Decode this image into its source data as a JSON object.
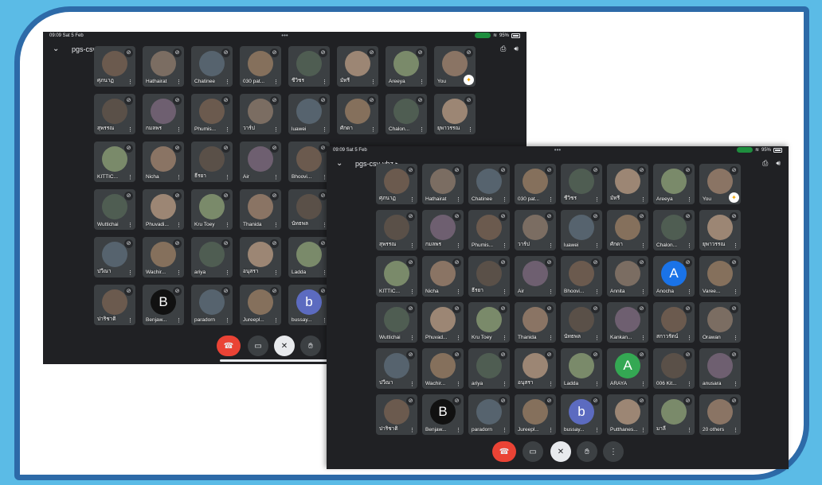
{
  "screen_a": {
    "time": "09:09  Sat 5 Feb",
    "battery": "95%",
    "meeting_code": "pgs-csv-yhz",
    "participants": [
      "ศุภนาฏ",
      "Hathairat",
      "Chatinee",
      "030 pat...",
      "ชีวิชร",
      "มัทรี",
      "Areeya",
      "You",
      "สุพรรณ",
      "กมลพร",
      "Phumis...",
      "วาร์ป",
      "luawei",
      "ศักดา",
      "Chalon...",
      "ยุพาวรรณ",
      "KITTIC...",
      "Nicha",
      "ธีรยา",
      "Air",
      "Bhoovi...",
      "",
      "",
      "",
      "Wuttichai",
      "Phuvadi...",
      "Kru Toey",
      "Thanida",
      "นัทธพล",
      "",
      "",
      "",
      "ปวีณา",
      "Wachir...",
      "ariya",
      "อนุสรา",
      "Ladda",
      "",
      "",
      "",
      "ปาริชาติ",
      "Benjaw...",
      "paradorn",
      "Jureepl...",
      "bussay...",
      "",
      "",
      ""
    ]
  },
  "screen_b": {
    "time": "09:09  Sat 5 Feb",
    "battery": "95%",
    "meeting_code": "pgs-csv-yhz",
    "participants": [
      "ศุภนาฏ",
      "Hathairat",
      "Chatinee",
      "030 pat...",
      "ชีวิชร",
      "มัทรี",
      "Areeya",
      "You",
      "สุพรรณ",
      "กมลพร",
      "Phumis...",
      "วาร์ป",
      "luawei",
      "ศักดา",
      "Chalon...",
      "ยุพาวรรณ",
      "KITTIC...",
      "Nicha",
      "ธีรยา",
      "Air",
      "Bhoovi...",
      "Annita",
      "Anocha",
      "Varee...",
      "Wuttichai",
      "Phuvad...",
      "Kru Toey",
      "Thanida",
      "นัทธพล",
      "Kankan...",
      "สกาวรัตน์",
      "Orawan",
      "ปวีณา",
      "Wachir...",
      "ariya",
      "อนุสรา",
      "Ladda",
      "ARAYA",
      "006 Kit...",
      "anusara",
      "ปาริชาติ",
      "Benjaw...",
      "paradorn",
      "Jureepl...",
      "bussay...",
      "Putthanes...",
      "มาลี",
      "20 others"
    ]
  },
  "letters": {
    "Anocha": "A",
    "ARAYA": "A",
    "bussay...": "b",
    "Benjaw...": "B"
  },
  "colors": {
    "meet_bg": "#202124",
    "end_call": "#ea4335",
    "tile": "#3c4043",
    "frame_border": "#2d6aa8",
    "outer_bg": "#5bbbe6"
  },
  "icons": [
    "chevron-down-icon",
    "camera-switch-icon",
    "speaker-icon",
    "mic-off-icon",
    "more-vert-icon",
    "end-call-icon",
    "camera-icon",
    "raise-hand-icon"
  ]
}
